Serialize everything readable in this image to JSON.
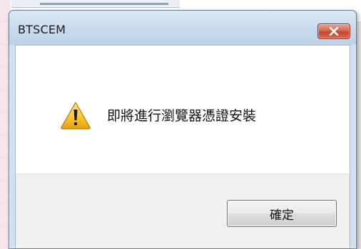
{
  "dialog": {
    "title": "BTSCEM",
    "message": "即將進行瀏覽器憑證安裝",
    "ok_label": "確定",
    "icon": "warning-icon",
    "close_icon": "close-icon"
  },
  "colors": {
    "titlebar": "#c9dcee",
    "close_button": "#c64733",
    "footer": "#f0f0f0",
    "warning_fill": "#f7c632"
  }
}
